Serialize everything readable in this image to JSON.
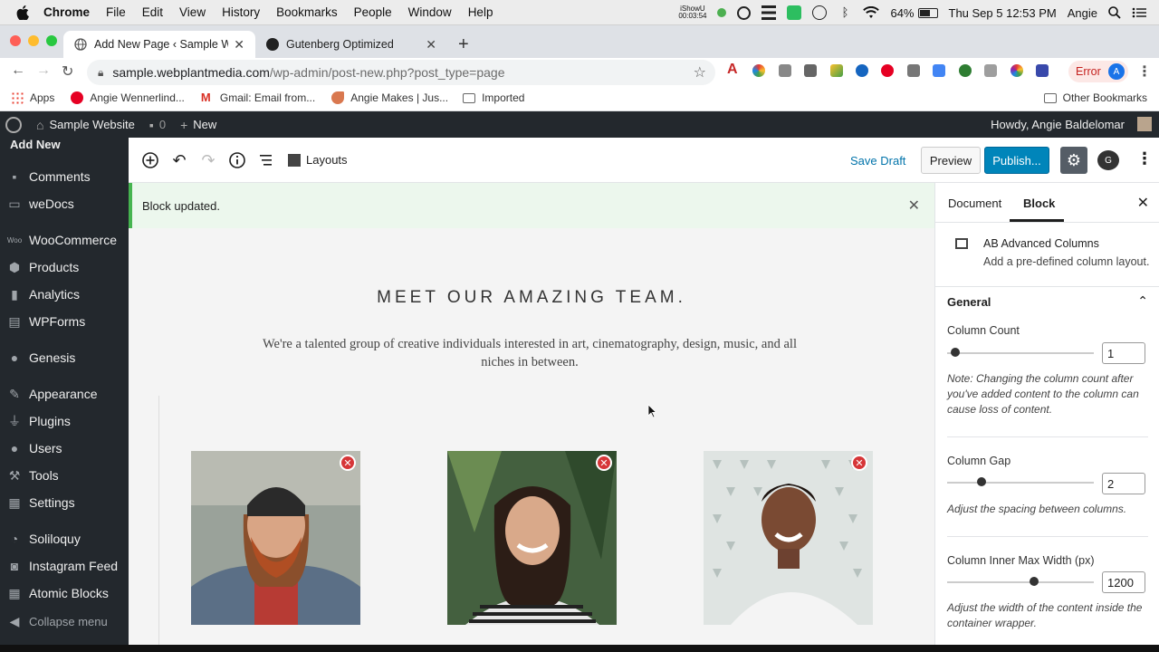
{
  "macos": {
    "menus": [
      "Chrome",
      "File",
      "Edit",
      "View",
      "History",
      "Bookmarks",
      "People",
      "Window",
      "Help"
    ],
    "ishow_label": "iShowU",
    "ishow_time": "00:03:54",
    "battery_pct": "64%",
    "battery_level": 0.64,
    "clock": "Thu Sep 5  12:53 PM",
    "user": "Angie"
  },
  "chrome": {
    "tabs": [
      {
        "label": "Add New Page ‹ Sample Websi",
        "active": true
      },
      {
        "label": "Gutenberg Optimized",
        "active": false
      }
    ],
    "url_host": "sample.webplantmedia.com",
    "url_path": "/wp-admin/post-new.php?post_type=page",
    "error_label": "Error",
    "profile_initial": "A",
    "bookmarks": [
      "Apps",
      "Angie Wennerlind...",
      "Gmail: Email from...",
      "Angie Makes | Jus...",
      "Imported"
    ],
    "other_bookmarks": "Other Bookmarks"
  },
  "adminbar": {
    "site_name": "Sample Website",
    "comments_count": "0",
    "new_label": "New",
    "howdy": "Howdy, Angie Baldelomar"
  },
  "sidebar": {
    "current": "Add New",
    "items": [
      "Comments",
      "weDocs",
      "WooCommerce",
      "Products",
      "Analytics",
      "WPForms",
      "Genesis",
      "Appearance",
      "Plugins",
      "Users",
      "Tools",
      "Settings",
      "Soliloquy",
      "Instagram Feed",
      "Atomic Blocks"
    ],
    "collapse": "Collapse menu"
  },
  "editor": {
    "layouts_label": "Layouts",
    "save_draft": "Save Draft",
    "preview": "Preview",
    "publish": "Publish...",
    "plugin_initial": "G",
    "notice": "Block updated."
  },
  "content": {
    "title": "MEET OUR AMAZING TEAM.",
    "subtitle": "We're a talented group of creative individuals interested in art, cinematography, design, music, and all niches in between."
  },
  "panel": {
    "tab_document": "Document",
    "tab_block": "Block",
    "block_name": "AB Advanced Columns",
    "block_desc": "Add a pre-defined column layout.",
    "section": "General",
    "column_count_label": "Column Count",
    "column_count": "1",
    "column_count_note": "Note: Changing the column count after you've added content to the column can cause loss of content.",
    "column_gap_label": "Column Gap",
    "column_gap": "2",
    "column_gap_help": "Adjust the spacing between columns.",
    "max_width_label": "Column Inner Max Width (px)",
    "max_width": "1200",
    "max_width_help": "Adjust the width of the content inside the container wrapper."
  }
}
